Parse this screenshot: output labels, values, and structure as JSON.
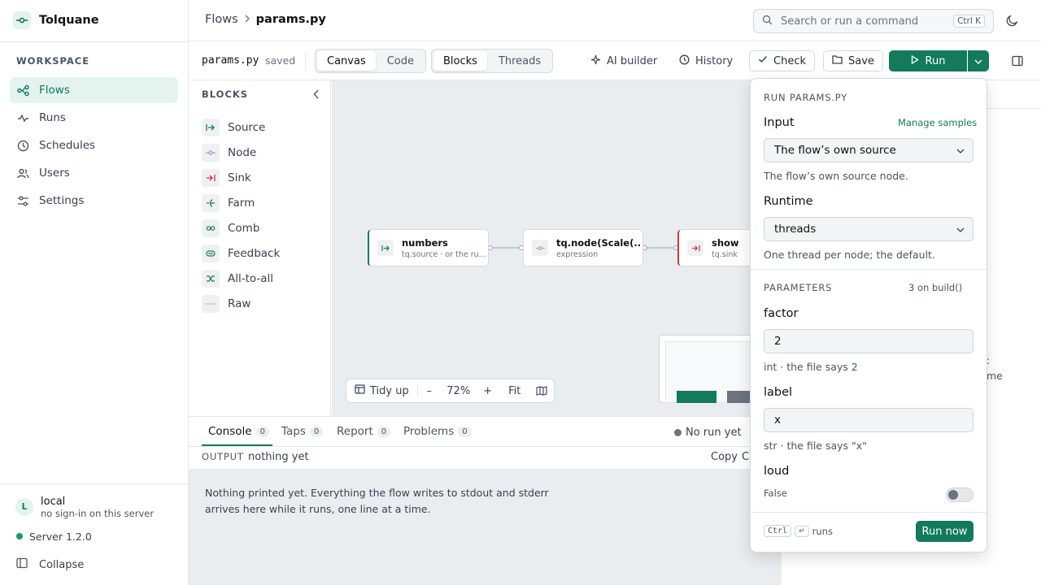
{
  "app": {
    "name": "Tolquane"
  },
  "sidebar": {
    "section": "WORKSPACE",
    "items": [
      {
        "label": "Flows",
        "icon": "flows-icon",
        "active": true
      },
      {
        "label": "Runs",
        "icon": "activity-icon"
      },
      {
        "label": "Schedules",
        "icon": "clock-icon"
      },
      {
        "label": "Users",
        "icon": "users-icon"
      },
      {
        "label": "Settings",
        "icon": "sliders-icon"
      }
    ],
    "user": {
      "initial": "L",
      "name": "local",
      "sub": "no sign-in on this server"
    },
    "server": "Server 1.2.0",
    "collapse": "Collapse"
  },
  "header": {
    "breadcrumb": [
      "Flows",
      "params.py"
    ],
    "search_placeholder": "Search or run a command",
    "search_shortcut": "Ctrl K"
  },
  "toolbar": {
    "file": "params.py",
    "status": "saved",
    "view_tabs": [
      "Canvas",
      "Code"
    ],
    "mode_tabs": [
      "Blocks",
      "Threads"
    ],
    "ai_builder": "AI builder",
    "history": "History",
    "check": "Check",
    "save": "Save",
    "run": "Run"
  },
  "blocks": {
    "title": "BLOCKS",
    "items": [
      "Source",
      "Node",
      "Sink",
      "Farm",
      "Comb",
      "Feedback",
      "All-to-all",
      "Raw"
    ]
  },
  "canvas": {
    "nodes": [
      {
        "title": "numbers",
        "sub": "tq.source · or the ru...",
        "accent": "#137a5b"
      },
      {
        "title": "tq.node(Scale(...",
        "sub": "expression",
        "accent": ""
      },
      {
        "title": "show",
        "sub": "tq.sink",
        "accent": "#d1343e"
      }
    ],
    "zoom": {
      "tidy": "Tidy up",
      "minus": "–",
      "level": "72%",
      "plus": "+",
      "fit": "Fit"
    }
  },
  "console": {
    "tabs": [
      {
        "label": "Console",
        "count": "0"
      },
      {
        "label": "Taps",
        "count": "0"
      },
      {
        "label": "Report",
        "count": "0"
      },
      {
        "label": "Problems",
        "count": "0"
      }
    ],
    "run_status": "No run yet",
    "output_label": "OUTPUT",
    "output_value": "nothing yet",
    "copy": "Copy",
    "clear_partial": "C",
    "empty_line1": "Nothing printed yet. Everything the flow writes to stdout and stderr",
    "empty_line2": "arrives here while it runs, one line at a time."
  },
  "right_panel": {
    "fragment1": ":",
    "fragment2": "me"
  },
  "run_popover": {
    "title": "RUN PARAMS.PY",
    "input_label": "Input",
    "manage_samples": "Manage samples",
    "input_value": "The flow’s own source",
    "input_hint": "The flow’s own source node.",
    "runtime_label": "Runtime",
    "runtime_value": "threads",
    "runtime_hint": "One thread per node; the default.",
    "params_title": "PARAMETERS",
    "params_count": "3 on build()",
    "params": [
      {
        "name": "factor",
        "value": "2",
        "hint": "int · the file says 2"
      },
      {
        "name": "label",
        "value": "x",
        "hint": "str · the file says \"x\""
      }
    ],
    "toggle": {
      "name": "loud",
      "value": "False",
      "on": false
    },
    "shortcut_key": "Ctrl",
    "shortcut_enter": "↵",
    "shortcut_text": "runs",
    "run_now": "Run now"
  },
  "colors": {
    "accent": "#137a5b",
    "accent_soft": "#e4f3ee",
    "sink": "#d1343e",
    "status_green": "#1a9b5f"
  }
}
